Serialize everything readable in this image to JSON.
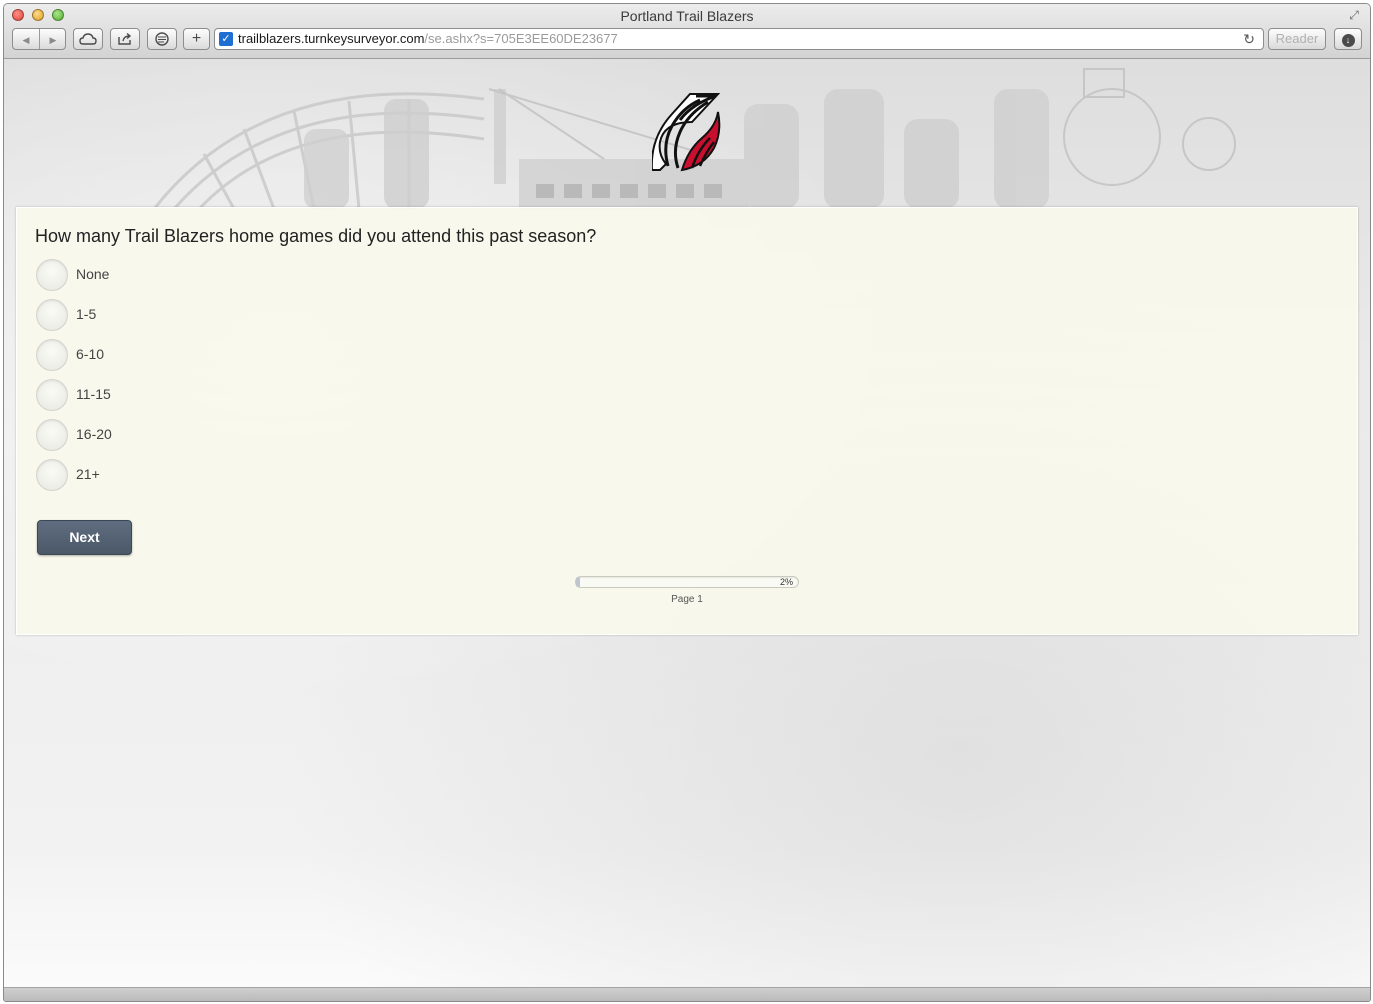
{
  "window": {
    "title": "Portland Trail Blazers"
  },
  "toolbar": {
    "back_icon": "◀",
    "forward_icon": "▶",
    "add_tab_label": "+",
    "reader_label": "Reader",
    "reload_icon": "↻",
    "download_icon": "↓"
  },
  "address_bar": {
    "favicon_glyph": "✓",
    "url_host": "trailblazers.turnkeysurveyor.com",
    "url_path": "/se.ashx?s=705E3EE60DE23677"
  },
  "survey": {
    "question": "How many Trail Blazers home games did you attend this past season?",
    "options": [
      "None",
      "1-5",
      "6-10",
      "11-15",
      "16-20",
      "21+"
    ],
    "next_label": "Next",
    "progress": {
      "percent": 2,
      "percent_label": "2%",
      "page_label": "Page 1"
    }
  },
  "colors": {
    "logo_red": "#c8102e",
    "logo_black": "#111111",
    "button_bg": "#56627a",
    "card_bg": "#f9f8ec"
  }
}
